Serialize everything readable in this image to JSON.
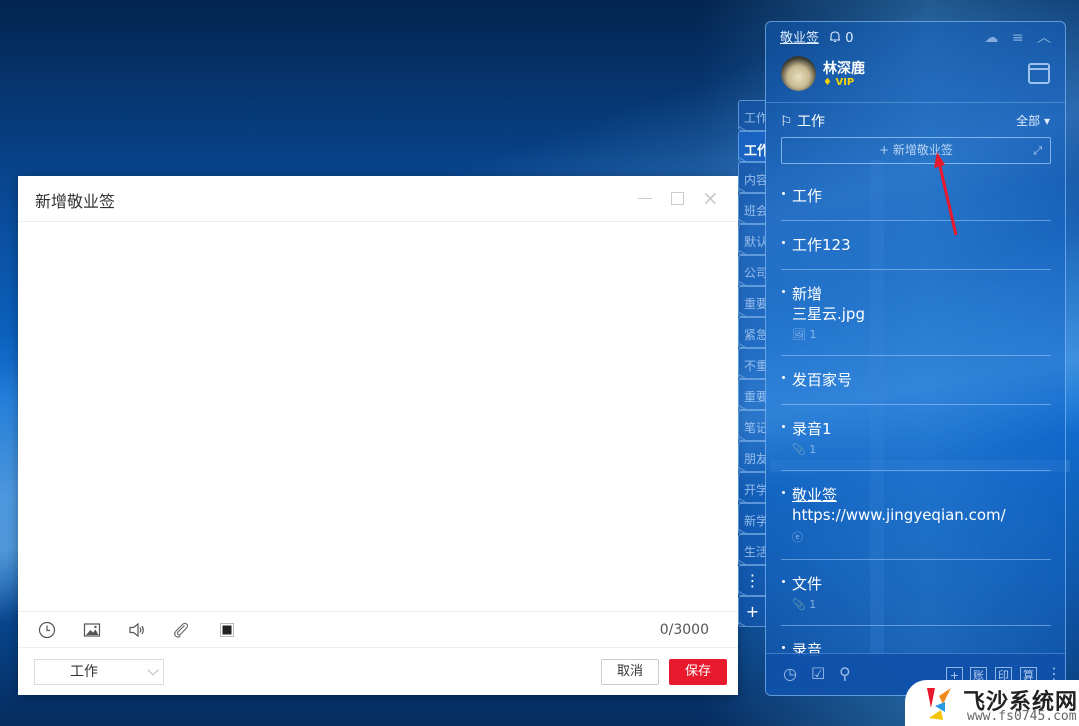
{
  "dialog": {
    "title": "新增敬业签",
    "minimize_label": "minimize",
    "maximize_label": "maximize",
    "close_glyph": "×",
    "editor_placeholder": "",
    "counter": "0/3000",
    "toolbar_icons": [
      "clock-icon",
      "image-icon",
      "speaker-icon",
      "paperclip-icon",
      "stop-icon"
    ],
    "category": "工作",
    "cancel_label": "取消",
    "save_label": "保存",
    "colors": {
      "save": "#e8192c"
    }
  },
  "side_tabs": {
    "items": [
      {
        "label": "工作",
        "active": false
      },
      {
        "label": "工作",
        "active": true
      },
      {
        "label": "内容"
      },
      {
        "label": "班会"
      },
      {
        "label": "默认"
      },
      {
        "label": "公司"
      },
      {
        "label": "重要"
      },
      {
        "label": "紧急"
      },
      {
        "label": "不重"
      },
      {
        "label": "重要"
      },
      {
        "label": "笔记"
      },
      {
        "label": "朋友"
      },
      {
        "label": "开学"
      },
      {
        "label": "新学"
      },
      {
        "label": "生活"
      }
    ],
    "more_glyph": "⋮",
    "add_glyph": "+"
  },
  "panel": {
    "brand": "敬业签",
    "bell_glyph": "🔔",
    "notification_count": "0",
    "top_icons": {
      "cloud": "☁",
      "menu": "≡",
      "collapse": "︿"
    },
    "user": {
      "name": "林深鹿",
      "badge": "VIP"
    },
    "category_icon": "⚐",
    "category": "工作",
    "filter": "全部 ▾",
    "add_note": "+ 新增敬业签",
    "expand_glyph": "⤢",
    "notes": [
      {
        "lines": [
          "工作"
        ]
      },
      {
        "lines": [
          "工作123"
        ]
      },
      {
        "lines": [
          "新增",
          "三星云.jpg"
        ],
        "meta_icon": "🖼",
        "meta": "1"
      },
      {
        "lines": [
          "发百家号"
        ]
      },
      {
        "lines": [
          "录音1"
        ],
        "meta_icon": "📎",
        "meta": "1"
      },
      {
        "lines": [
          "敬业签",
          "https://www.jingyeqian.com/"
        ],
        "meta_icon": "ⓔ",
        "meta": ""
      },
      {
        "lines": [
          "文件"
        ],
        "meta_icon": "📎",
        "meta": "1"
      },
      {
        "lines": [
          "录音"
        ]
      }
    ],
    "bottom_icons": {
      "clock": "◷",
      "checkbox": "☑",
      "search": "⚲"
    },
    "bottom_boxes": [
      "+",
      "账",
      "印",
      "算"
    ],
    "more_glyph": "⋮"
  },
  "watermark": {
    "name": "飞沙系统网",
    "url": "www.fs0745.com"
  }
}
